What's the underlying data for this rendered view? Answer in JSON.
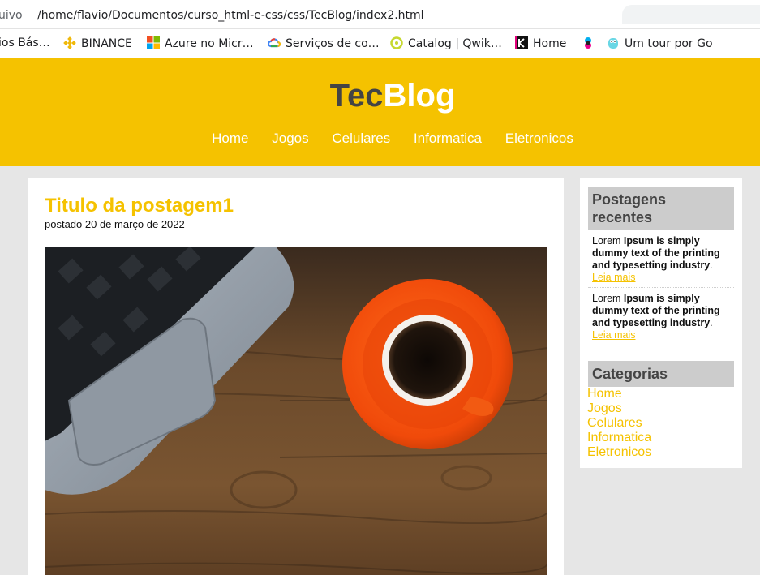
{
  "browser": {
    "url_prefix": "uivo",
    "url": "/home/flavio/Documentos/curso_html-e-css/css/TecBlog/index2.html",
    "bookmarks": [
      {
        "label": "ios Bás…",
        "icon": "page-icon"
      },
      {
        "label": "BINANCE",
        "icon": "binance-icon"
      },
      {
        "label": "Azure no Micr…",
        "icon": "microsoft-icon"
      },
      {
        "label": "Serviços de co…",
        "icon": "google-cloud-icon"
      },
      {
        "label": "Catalog | Qwik…",
        "icon": "qwiklabs-icon"
      },
      {
        "label": "Home",
        "icon": "k-icon"
      },
      {
        "label": "",
        "icon": "color-dots-icon"
      },
      {
        "label": "Um tour por Go",
        "icon": "gopher-icon"
      }
    ]
  },
  "site": {
    "logo_dark": "Tec",
    "logo_light": "Blog",
    "nav": [
      "Home",
      "Jogos",
      "Celulares",
      "Informatica",
      "Eletronicos"
    ]
  },
  "post": {
    "title": "Titulo da postagem1",
    "date": "postado 20 de março de 2022",
    "image_alt": "laptop-and-coffee-photo"
  },
  "sidebar": {
    "recent_title": "Postagens recentes",
    "recent": [
      {
        "prefix": "Lorem ",
        "bold": "Ipsum is simply dummy text of the printing and typesetting industry",
        "suffix": ".",
        "more": "Leia mais"
      },
      {
        "prefix": "Lorem ",
        "bold": "Ipsum is simply dummy text of the printing and typesetting industry",
        "suffix": ".",
        "more": "Leia mais"
      }
    ],
    "categories_title": "Categorias",
    "categories": [
      "Home",
      "Jogos",
      "Celulares",
      "Informatica",
      "Eletronicos"
    ]
  },
  "colors": {
    "accent": "#f5c200",
    "logo_dark": "#444444",
    "page_bg": "#e6e6e6",
    "sidebar_head_bg": "#cccccc"
  }
}
